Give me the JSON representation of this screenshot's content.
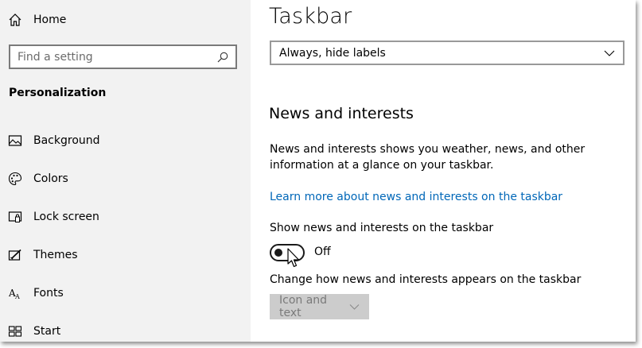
{
  "sidebar": {
    "home_label": "Home",
    "search_placeholder": "Find a setting",
    "section_title": "Personalization",
    "items": [
      {
        "label": "Background",
        "icon": "picture-icon"
      },
      {
        "label": "Colors",
        "icon": "palette-icon"
      },
      {
        "label": "Lock screen",
        "icon": "lock-screen-icon"
      },
      {
        "label": "Themes",
        "icon": "themes-icon"
      },
      {
        "label": "Fonts",
        "icon": "font-icon"
      },
      {
        "label": "Start",
        "icon": "start-icon"
      }
    ]
  },
  "main": {
    "page_title": "Taskbar",
    "labels_dropdown": {
      "value": "Always, hide labels"
    },
    "news_heading": "News and interests",
    "news_description": "News and interests shows you weather, news, and other information at a glance on your taskbar.",
    "learn_more_link": "Learn more about news and interests on the taskbar",
    "show_news_label": "Show news and interests on the taskbar",
    "toggle": {
      "state": "Off",
      "on": false
    },
    "appearance_label": "Change how news and interests appears on the taskbar",
    "appearance_select": {
      "value": "Icon and text",
      "disabled": true
    }
  },
  "colors": {
    "sidebar_bg": "#f2f2f2",
    "link": "#0067b8",
    "disabled_bg": "#cccccc"
  }
}
